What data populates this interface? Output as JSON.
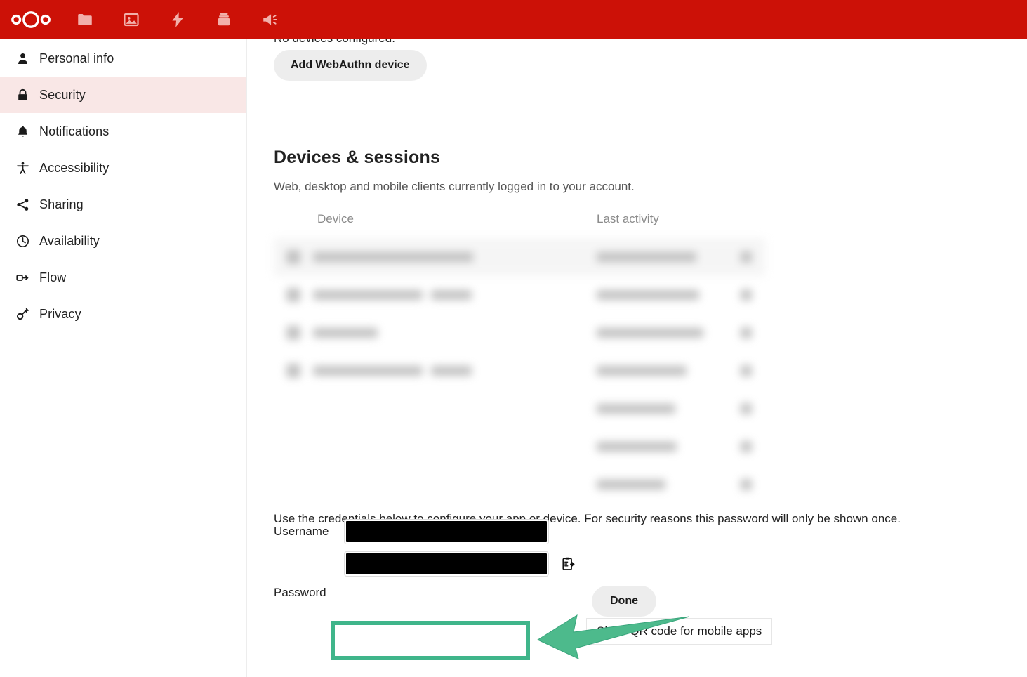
{
  "header": {
    "brand_name": "Nextcloud",
    "background_color": "#cc1107",
    "apps": [
      {
        "name": "files-app",
        "label": "Files",
        "icon": "folder-icon"
      },
      {
        "name": "photos-app",
        "label": "Photos",
        "icon": "image-icon"
      },
      {
        "name": "activity-app",
        "label": "Activity",
        "icon": "lightning-icon"
      },
      {
        "name": "deck-app",
        "label": "Deck",
        "icon": "layers-icon"
      },
      {
        "name": "announcements-app",
        "label": "Announcements",
        "icon": "megaphone-icon"
      }
    ]
  },
  "sidebar": {
    "active_item": "Security",
    "active_background": "#f9e7e6",
    "items": [
      {
        "label": "Personal info",
        "icon": "user-icon"
      },
      {
        "label": "Security",
        "icon": "lock-icon"
      },
      {
        "label": "Notifications",
        "icon": "bell-icon"
      },
      {
        "label": "Accessibility",
        "icon": "accessibility-icon"
      },
      {
        "label": "Sharing",
        "icon": "share-icon"
      },
      {
        "label": "Availability",
        "icon": "clock-icon"
      },
      {
        "label": "Flow",
        "icon": "flow-icon"
      },
      {
        "label": "Privacy",
        "icon": "key-icon"
      }
    ]
  },
  "webauthn": {
    "no_devices_text": "No devices configured.",
    "add_device_label": "Add WebAuthn device"
  },
  "devices_section": {
    "title": "Devices & sessions",
    "description": "Web, desktop and mobile clients currently logged in to your account.",
    "columns": {
      "device": "Device",
      "last_activity": "Last activity"
    },
    "rows": [
      {
        "device": "",
        "last_activity": "",
        "current": true
      },
      {
        "device": "",
        "last_activity": "",
        "current": false
      },
      {
        "device": "",
        "last_activity": "",
        "current": false
      },
      {
        "device": "",
        "last_activity": "",
        "current": false
      },
      {
        "device": "",
        "last_activity": "",
        "current": false
      },
      {
        "device": "",
        "last_activity": "",
        "current": false
      },
      {
        "device": "",
        "last_activity": "",
        "current": false
      }
    ]
  },
  "credentials": {
    "note": "Use the credentials below to configure your app or device. For security reasons this password will only be shown once.",
    "username_label": "Username",
    "username_value": "",
    "password_label": "Password",
    "password_value": "",
    "copy_icon": "clipboard-copy-icon",
    "done_label": "Done",
    "qr_link_label": "Show QR code for mobile apps"
  },
  "annotation": {
    "highlight_color": "#3fb58a",
    "arrow_color": "#4dba8c",
    "target": "Show QR code for mobile apps"
  }
}
